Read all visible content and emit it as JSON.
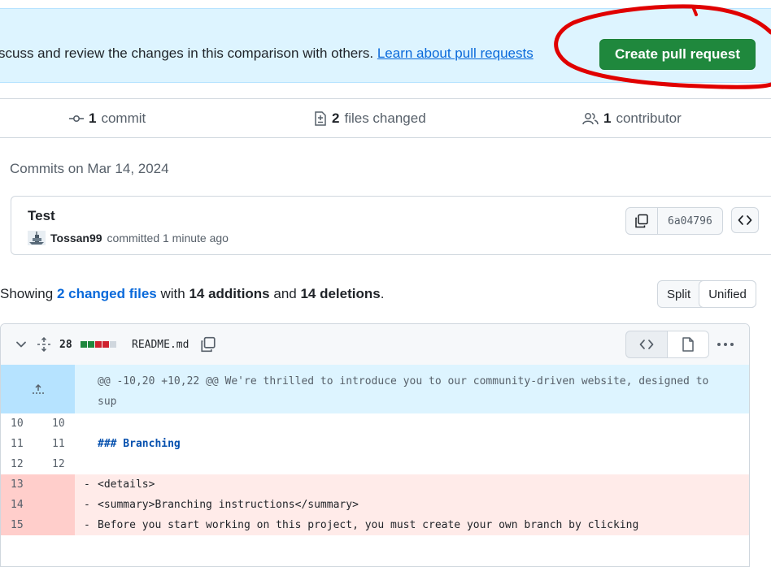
{
  "banner": {
    "text": "scuss and review the changes in this comparison with others. ",
    "link": "Learn about pull requests",
    "create_button": "Create pull request"
  },
  "stats": {
    "commits_count": "1",
    "commits_label": "commit",
    "files_count": "2",
    "files_label": "files changed",
    "contributors_count": "1",
    "contributors_label": "contributor"
  },
  "commits": {
    "date_heading": "Commits on Mar 14, 2024",
    "items": [
      {
        "title": "Test",
        "author": "Tossan99",
        "meta": "committed 1 minute ago",
        "sha": "6a04796"
      }
    ]
  },
  "summary": {
    "prefix": "Showing ",
    "files_link": "2 changed files",
    "middle": " with ",
    "additions": "14 additions",
    "and": " and ",
    "deletions": "14 deletions",
    "suffix": ".",
    "split_label": "Split",
    "unified_label": "Unified"
  },
  "file": {
    "changes": "28",
    "name": "README.md",
    "diffstat_colors": [
      "#1f883d",
      "#1f883d",
      "#cf222e",
      "#cf222e",
      "#d0d7de"
    ],
    "hunk_header": "@@ -10,20 +10,22 @@ We're thrilled to introduce you to our community-driven website, designed to sup",
    "rows": [
      {
        "old": "10",
        "new": "10",
        "type": "context",
        "marker": "",
        "code": ""
      },
      {
        "old": "11",
        "new": "11",
        "type": "context",
        "marker": "",
        "code": "### Branching"
      },
      {
        "old": "12",
        "new": "12",
        "type": "context",
        "marker": "",
        "code": ""
      },
      {
        "old": "13",
        "new": "",
        "type": "del",
        "marker": "-",
        "code": "<details>"
      },
      {
        "old": "14",
        "new": "",
        "type": "del",
        "marker": "-",
        "code": "<summary>Branching instructions</summary>"
      },
      {
        "old": "15",
        "new": "",
        "type": "del",
        "marker": "-",
        "code": "Before you start working on this project, you must create your own branch by clicking"
      }
    ]
  },
  "colors": {
    "banner_bg": "#ddf4ff",
    "primary_button": "#1f883d",
    "link": "#0969da",
    "deletion_bg": "#ffebe9",
    "annotation_circle": "#e00000"
  }
}
